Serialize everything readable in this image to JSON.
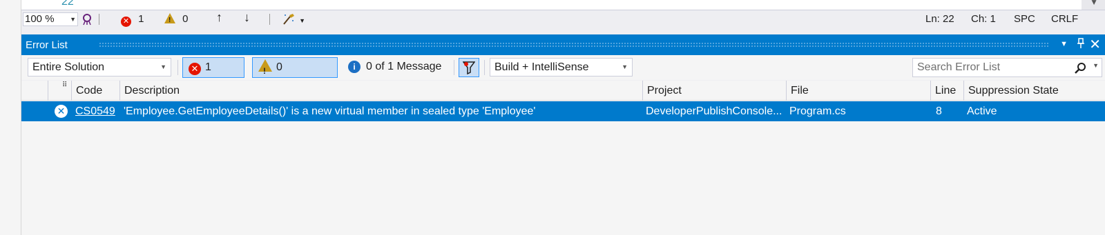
{
  "editor": {
    "line_number": "22"
  },
  "statusbar": {
    "zoom": "100 %",
    "error_count": "1",
    "warning_count": "0",
    "position_line": "Ln: 22",
    "position_char": "Ch: 1",
    "indent": "SPC",
    "line_ending": "CRLF"
  },
  "panel": {
    "title": "Error List"
  },
  "toolbar": {
    "scope": "Entire Solution",
    "errors_label": "1 Error",
    "warnings_label": "0 Warnings",
    "messages_label": "0 of 1 Message",
    "build_source": "Build + IntelliSense",
    "search_placeholder": "Search Error List"
  },
  "columns": [
    "Code",
    "Description",
    "Project",
    "File",
    "Line",
    "Suppression State"
  ],
  "rows": [
    {
      "code": "CS0549",
      "description": "'Employee.GetEmployeeDetails()' is a new virtual member in sealed type 'Employee'",
      "project": "DeveloperPublishConsole...",
      "file": "Program.cs",
      "line": "8",
      "suppression": "Active"
    }
  ],
  "colors": {
    "accent": "#007acc",
    "error": "#e51400",
    "warning": "#c89a1a",
    "info": "#1c6fc3"
  }
}
